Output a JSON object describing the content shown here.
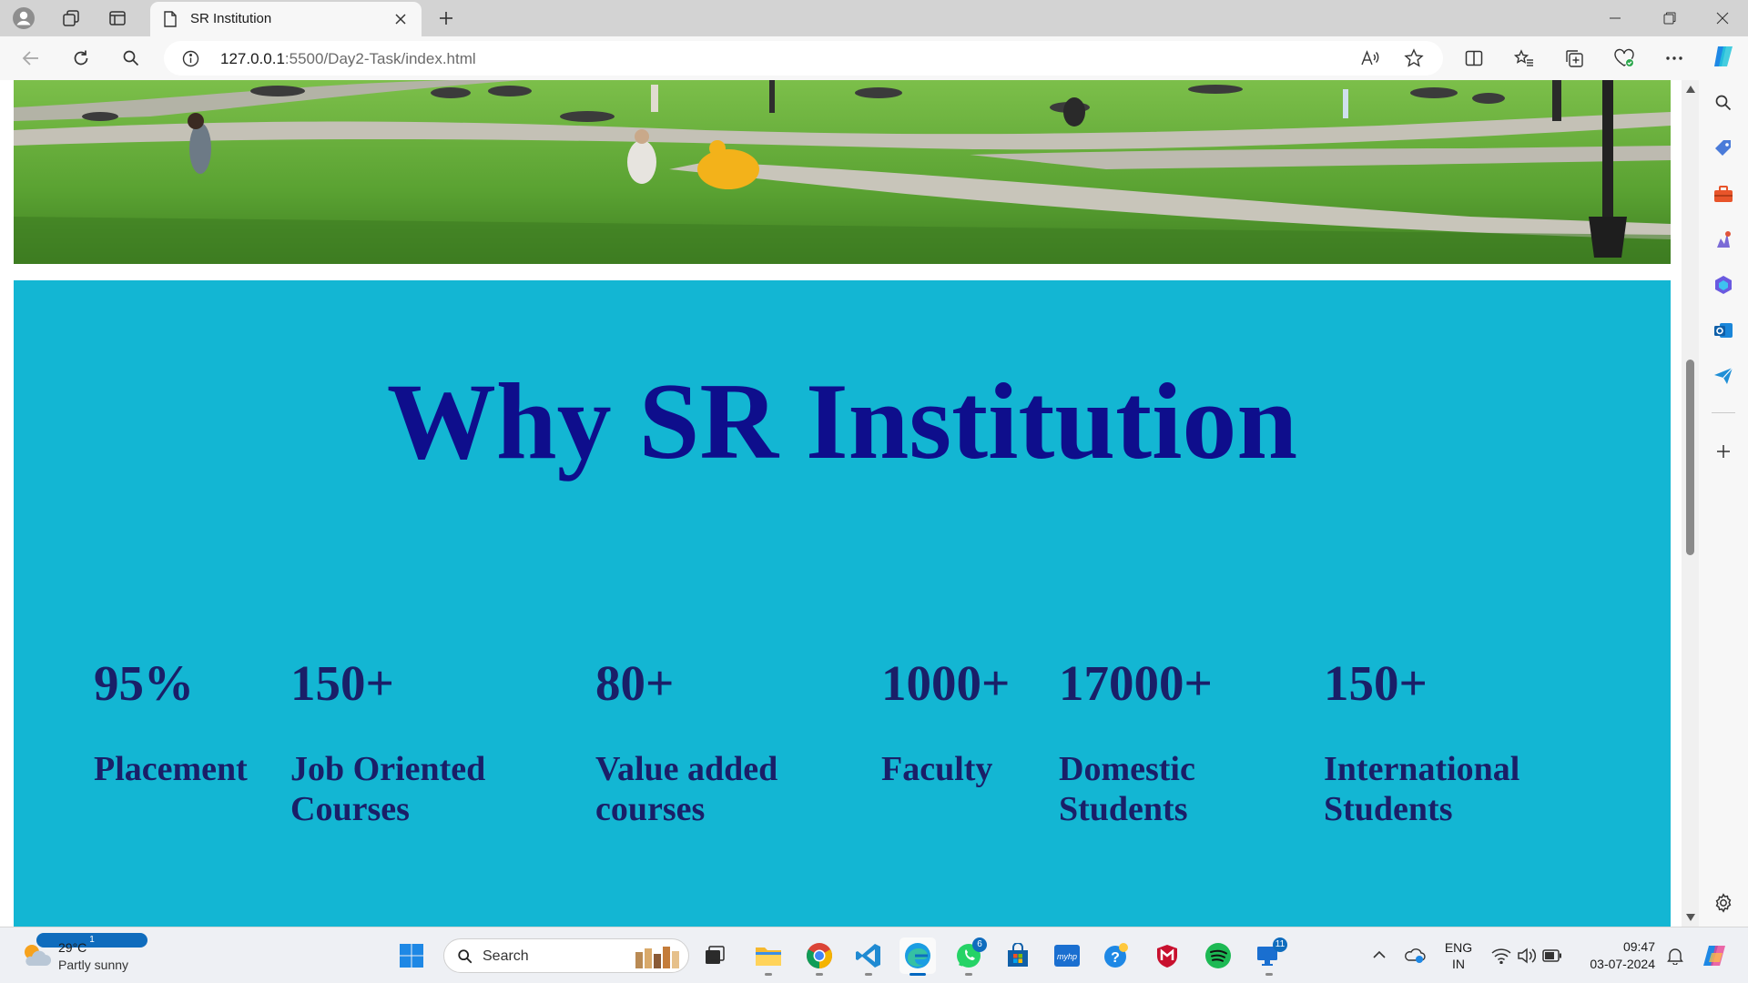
{
  "browser": {
    "tab": {
      "title": "SR Institution"
    },
    "address": {
      "host": "127.0.0.1",
      "path": ":5500/Day2-Task/index.html"
    }
  },
  "page": {
    "why": {
      "title": "Why SR Institution",
      "stats": [
        {
          "value": "95%",
          "label": "Placement"
        },
        {
          "value": "150+",
          "label": "Job Oriented Courses"
        },
        {
          "value": "80+",
          "label": "Value added courses"
        },
        {
          "value": "1000+",
          "label": "Faculty"
        },
        {
          "value": "17000+",
          "label": "Domestic Students"
        },
        {
          "value": "150+",
          "label": "International Students"
        }
      ]
    },
    "colors": {
      "section_bg": "#13b6d3",
      "title": "#0e0e8c",
      "stat_text": "#1a1f68"
    }
  },
  "taskbar": {
    "weather": {
      "temp": "29°C",
      "desc": "Partly sunny",
      "badge": "1"
    },
    "search_placeholder": "Search",
    "badges": {
      "whatsapp": "6",
      "remote": "11"
    },
    "tray": {
      "lang1": "ENG",
      "lang2": "IN",
      "time": "09:47",
      "date": "03-07-2024"
    }
  }
}
